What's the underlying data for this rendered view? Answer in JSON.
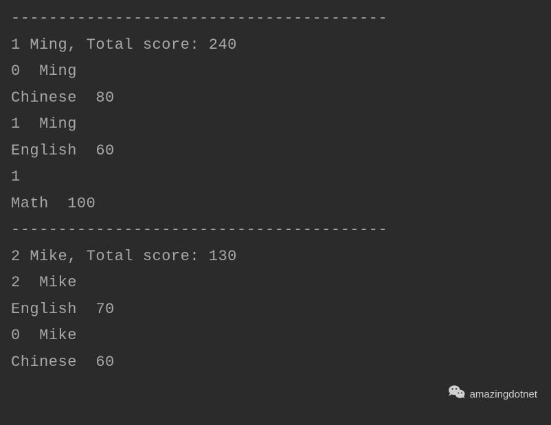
{
  "lines": [
    "----------------------------------------",
    "1 Ming, Total score: 240",
    "0  Ming",
    "Chinese  80",
    "1  Ming",
    "English  60",
    "1",
    "Math  100",
    "----------------------------------------",
    "2 Mike, Total score: 130",
    "2  Mike",
    "English  70",
    "0  Mike",
    "Chinese  60"
  ],
  "watermark": {
    "text": "amazingdotnet"
  }
}
